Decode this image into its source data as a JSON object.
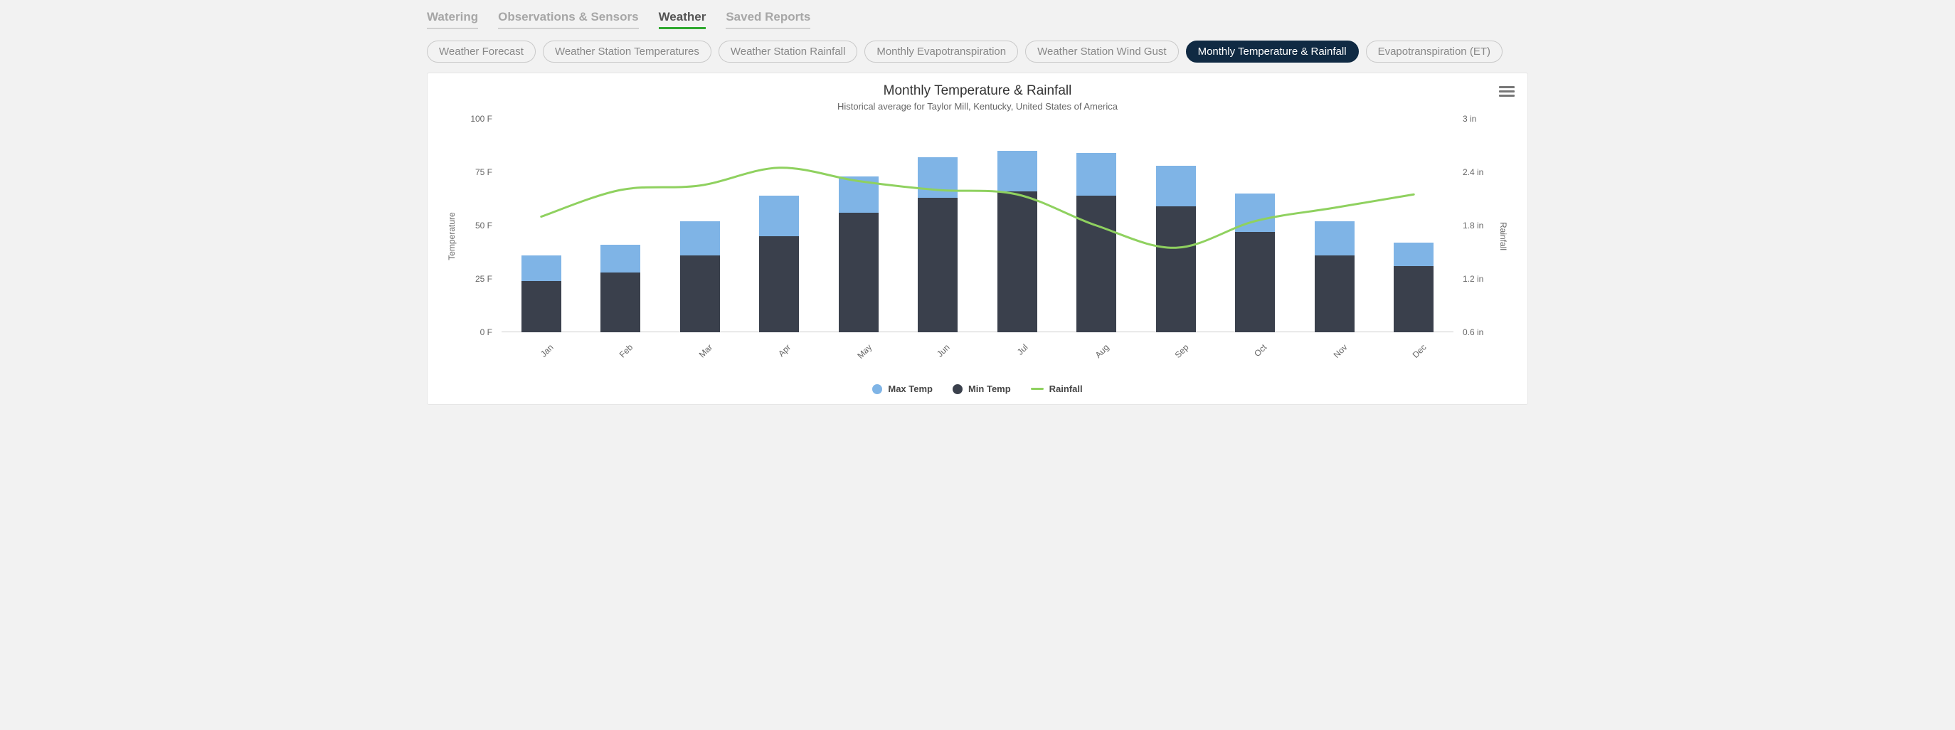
{
  "tabs": [
    {
      "id": "watering",
      "label": "Watering",
      "active": false
    },
    {
      "id": "observations",
      "label": "Observations & Sensors",
      "active": false
    },
    {
      "id": "weather",
      "label": "Weather",
      "active": true
    },
    {
      "id": "reports",
      "label": "Saved Reports",
      "active": false
    }
  ],
  "chips": [
    {
      "id": "forecast",
      "label": "Weather Forecast",
      "active": false
    },
    {
      "id": "station-temps",
      "label": "Weather Station Temperatures",
      "active": false
    },
    {
      "id": "station-rain",
      "label": "Weather Station Rainfall",
      "active": false
    },
    {
      "id": "monthly-et",
      "label": "Monthly Evapotranspiration",
      "active": false
    },
    {
      "id": "wind-gust",
      "label": "Weather Station Wind Gust",
      "active": false
    },
    {
      "id": "monthly-temp-rain",
      "label": "Monthly Temperature & Rainfall",
      "active": true
    },
    {
      "id": "et",
      "label": "Evapotranspiration (ET)",
      "active": false
    }
  ],
  "chart": {
    "title": "Monthly Temperature & Rainfall",
    "subtitle": "Historical average for Taylor Mill, Kentucky, United States of America",
    "y_left_label": "Temperature",
    "y_right_label": "Rainfall",
    "y_left_ticks": [
      "0 F",
      "25 F",
      "50 F",
      "75 F",
      "100 F"
    ],
    "y_right_ticks": [
      "0.6 in",
      "1.2 in",
      "1.8 in",
      "2.4 in",
      "3 in"
    ],
    "legend": {
      "max": "Max Temp",
      "min": "Min Temp",
      "rain": "Rainfall"
    },
    "colors": {
      "max": "#7fb4e6",
      "min": "#3a404c",
      "rain": "#8fd15f"
    }
  },
  "chart_data": {
    "type": "bar",
    "categories": [
      "Jan",
      "Feb",
      "Mar",
      "Apr",
      "May",
      "Jun",
      "Jul",
      "Aug",
      "Sep",
      "Oct",
      "Nov",
      "Dec"
    ],
    "series": [
      {
        "name": "Max Temp",
        "values": [
          36,
          41,
          52,
          64,
          73,
          82,
          85,
          84,
          78,
          65,
          52,
          42
        ]
      },
      {
        "name": "Min Temp",
        "values": [
          24,
          28,
          36,
          45,
          56,
          63,
          66,
          64,
          59,
          47,
          36,
          31
        ]
      },
      {
        "name": "Rainfall",
        "values": [
          1.9,
          2.2,
          2.25,
          2.45,
          2.3,
          2.2,
          2.15,
          1.8,
          1.55,
          1.85,
          2.0,
          2.15
        ]
      }
    ],
    "title": "Monthly Temperature & Rainfall",
    "xlabel": "",
    "ylabel_left": "Temperature",
    "ylabel_right": "Rainfall",
    "ylim_left": [
      0,
      100
    ],
    "ylim_right": [
      0.6,
      3.0
    ]
  }
}
